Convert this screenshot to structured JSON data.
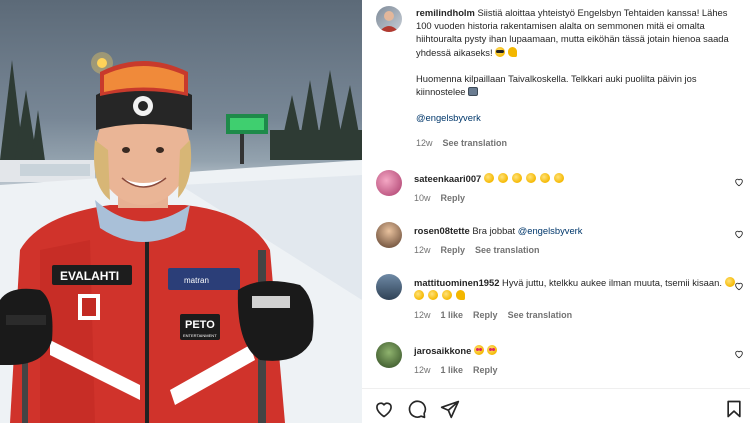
{
  "post": {
    "author": "remilindholm",
    "caption_p1": "Siistiä aloittaa yhteistyö Engelsbyn Tehtaiden kanssa! Lähes 100 vuoden historia rakentamisen alalta on semmonen mitä ei omalta hiihtouralta pysty ihan lupaamaan, mutta eiköhän tässä jotain hienoa saada yhdessä aikaseks!",
    "caption_p2": "Huomenna kilpaillaan Taivalkoskella. Telkkari auki puolilta päivin jos kiinnostelee",
    "mention": "@engelsbyverk",
    "age": "12w",
    "see_translation": "See translation"
  },
  "photo": {
    "jacket_sponsor_left": "EVALAHTI",
    "jacket_sponsor_right": "PETO",
    "jacket_sponsor_right_sub": "ENTERTAINMENT",
    "chest_badge": "matran"
  },
  "comments": [
    {
      "user": "sateenkaari007",
      "text": "",
      "emoji": "claps6",
      "age": "10w",
      "likes": "",
      "reply": "Reply",
      "translation": ""
    },
    {
      "user": "rosen08tette",
      "text": "Bra jobbat ",
      "mention": "@engelsbyverk",
      "age": "12w",
      "likes": "",
      "reply": "Reply",
      "translation": "See translation"
    },
    {
      "user": "mattituominen1952",
      "text": "Hyvä juttu, ktelkku aukee ilman muuta, tsemii kisaan.",
      "emoji": "claps5",
      "age": "12w",
      "likes": "1 like",
      "reply": "Reply",
      "translation": "See translation"
    },
    {
      "user": "jarosaikkone",
      "text": "",
      "emoji": "hearts2",
      "age": "12w",
      "likes": "1 like",
      "reply": "Reply",
      "translation": ""
    }
  ],
  "icons": {
    "like": "heart-icon",
    "comment": "comment-icon",
    "share": "share-icon",
    "save": "bookmark-icon"
  }
}
